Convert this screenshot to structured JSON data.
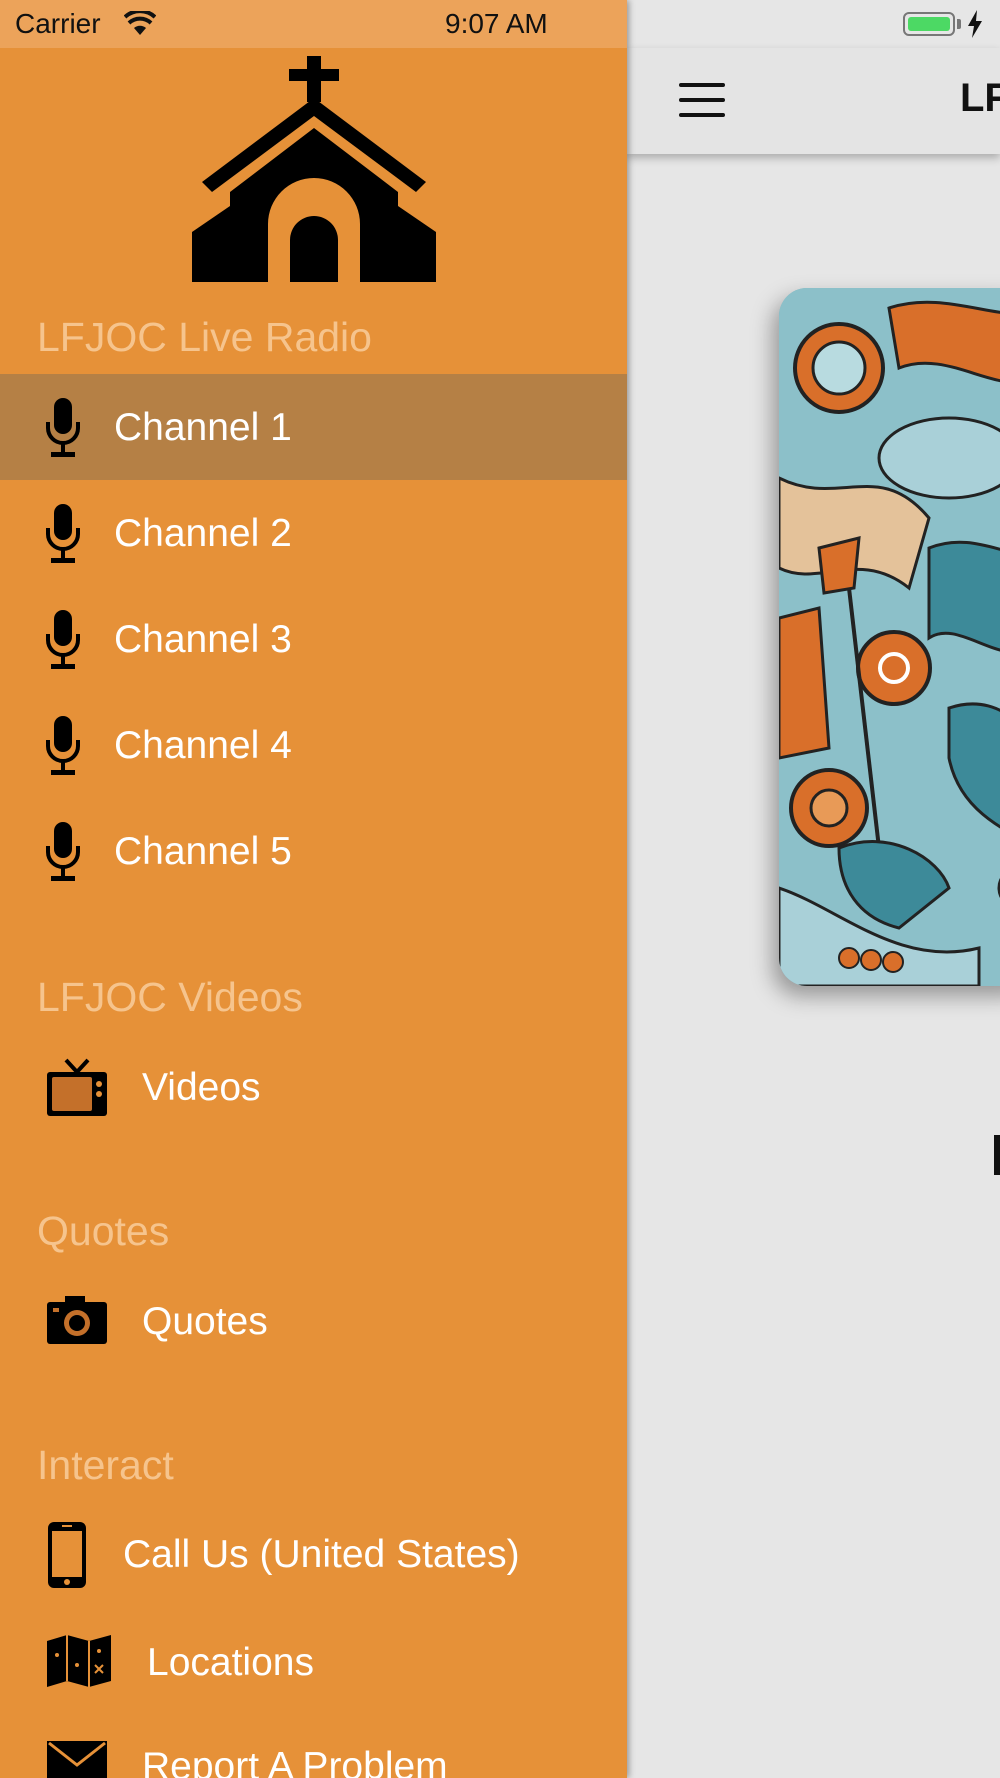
{
  "status_bar": {
    "carrier": "Carrier",
    "time": "9:07 AM"
  },
  "main": {
    "title": "LF"
  },
  "drawer": {
    "sections": [
      {
        "header": "LFJOC Live Radio",
        "items": [
          {
            "label": "Channel 1",
            "icon": "microphone-icon",
            "selected": true
          },
          {
            "label": "Channel 2",
            "icon": "microphone-icon"
          },
          {
            "label": "Channel 3",
            "icon": "microphone-icon"
          },
          {
            "label": "Channel 4",
            "icon": "microphone-icon"
          },
          {
            "label": "Channel 5",
            "icon": "microphone-icon"
          }
        ]
      },
      {
        "header": "LFJOC Videos",
        "items": [
          {
            "label": "Videos",
            "icon": "tv-icon"
          }
        ]
      },
      {
        "header": "Quotes",
        "items": [
          {
            "label": "Quotes",
            "icon": "camera-icon"
          }
        ]
      },
      {
        "header": "Interact",
        "items": [
          {
            "label": "Call Us (United States)",
            "icon": "phone-icon"
          },
          {
            "label": "Locations",
            "icon": "map-icon"
          },
          {
            "label": "Report A Problem",
            "icon": "mail-icon"
          }
        ]
      }
    ]
  },
  "colors": {
    "drawer_background": "#e69138",
    "selected_row": "#b58045",
    "section_header": "#f6c48d",
    "main_background": "#e6e6e6"
  }
}
